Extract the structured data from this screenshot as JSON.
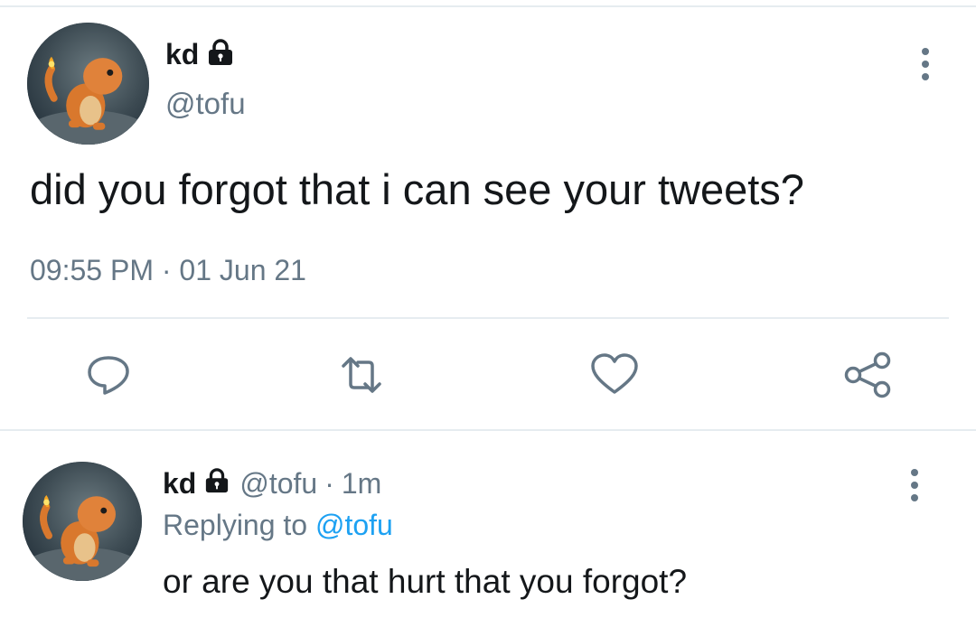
{
  "tweet": {
    "display_name": "kd",
    "handle": "@tofu",
    "protected_icon": "lock-icon",
    "more_icon": "more-vertical-icon",
    "text": "did you forgot that i can see your tweets?",
    "time": "09:55 PM",
    "separator": "·",
    "date": "01 Jun 21",
    "actions": {
      "reply_icon": "reply-icon",
      "retweet_icon": "retweet-icon",
      "like_icon": "heart-icon",
      "share_icon": "share-icon"
    }
  },
  "reply": {
    "display_name": "kd",
    "handle": "@tofu",
    "separator": "·",
    "time_ago": "1m",
    "replying_to_label": "Replying to",
    "replying_to_handle": "@tofu",
    "text": "or are you that hurt that you forgot?",
    "protected_icon": "lock-icon",
    "more_icon": "more-vertical-icon"
  },
  "colors": {
    "text_primary": "#14171a",
    "text_secondary": "#657786",
    "link": "#1da1f2",
    "divider": "#e6ecf0"
  }
}
